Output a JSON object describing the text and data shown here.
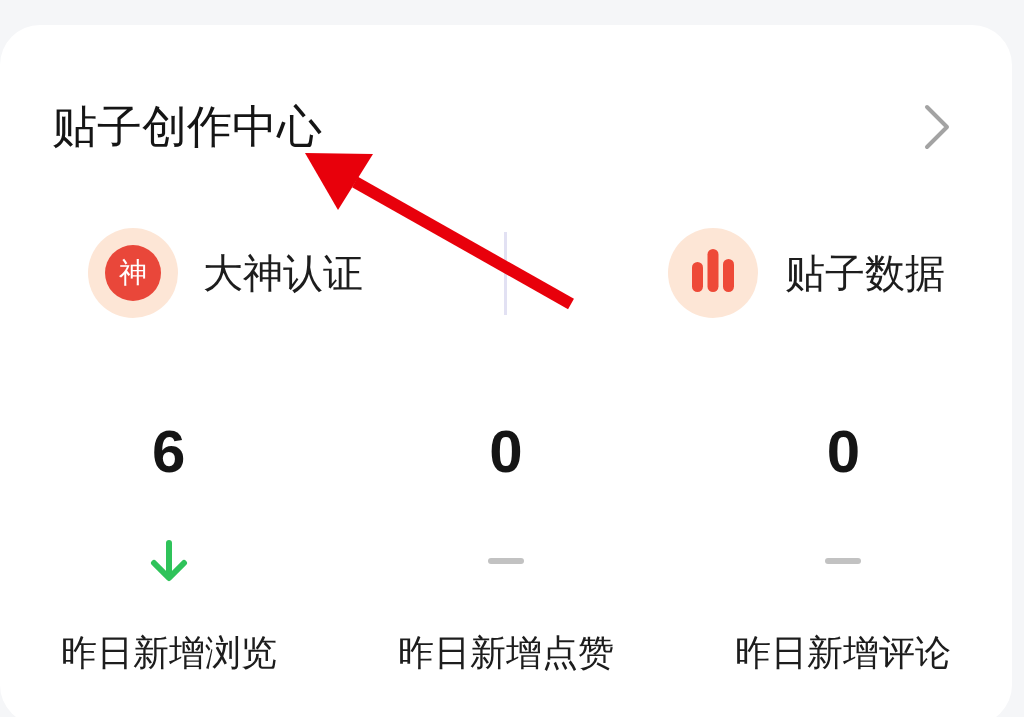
{
  "card": {
    "title": "贴子创作中心"
  },
  "shortcuts": [
    {
      "kind": "badge",
      "badge_text": "神",
      "label": "大神认证"
    },
    {
      "kind": "chart",
      "label": "贴子数据"
    }
  ],
  "stats": [
    {
      "kind": "down",
      "value": "6",
      "label": "昨日新增浏览"
    },
    {
      "kind": "flat",
      "value": "0",
      "label": "昨日新增点赞"
    },
    {
      "kind": "flat",
      "value": "0",
      "label": "昨日新增评论"
    }
  ]
}
